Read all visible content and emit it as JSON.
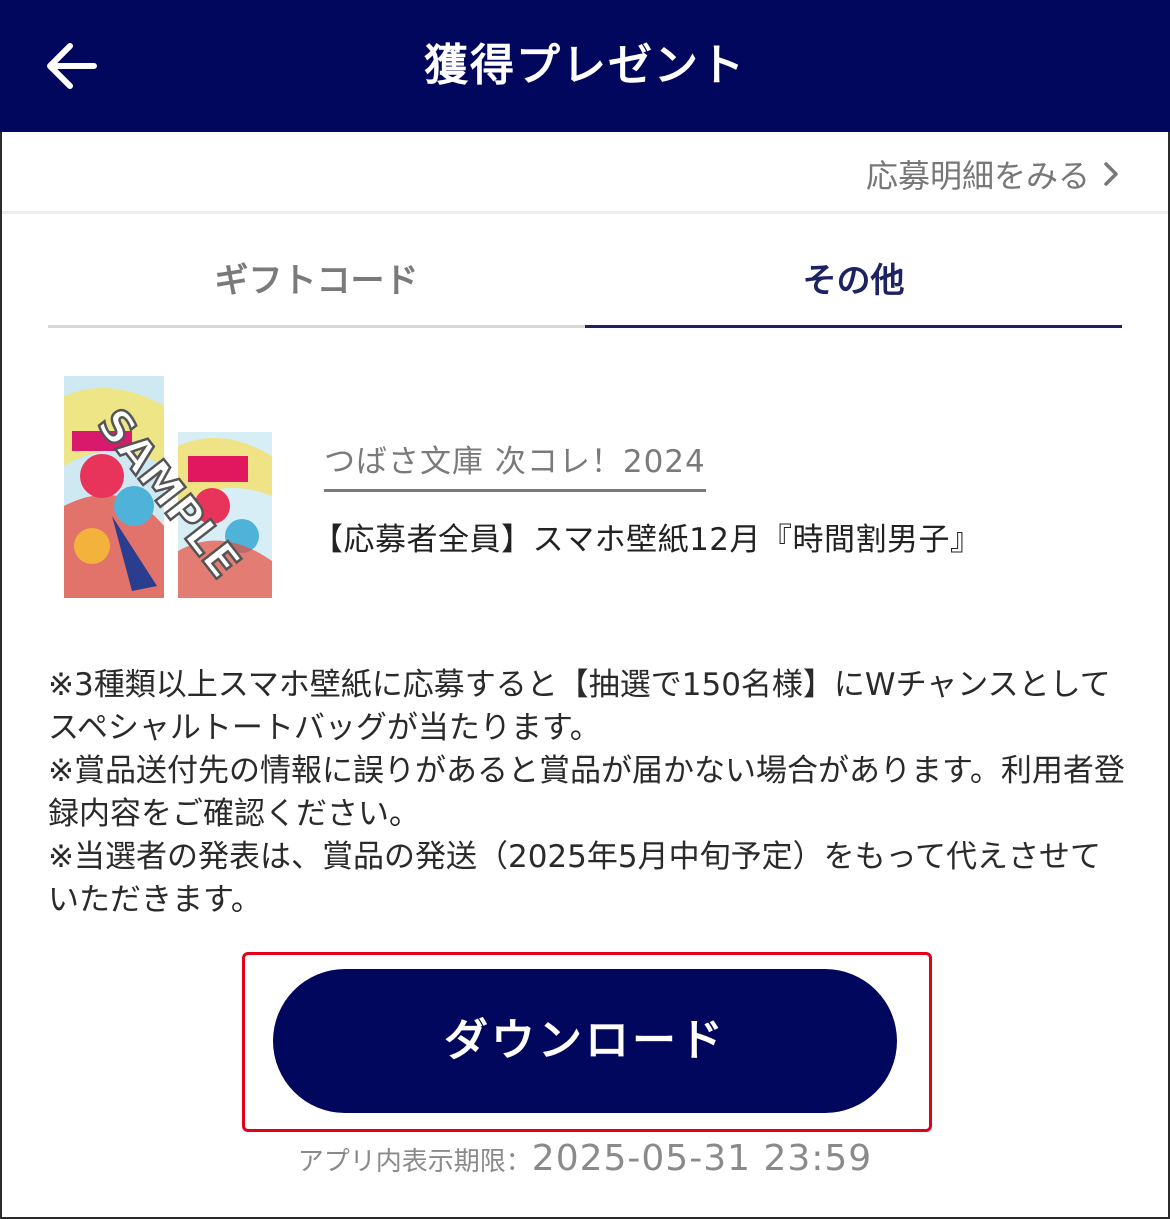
{
  "header": {
    "title": "獲得プレゼント",
    "back_icon": "arrow-left-icon"
  },
  "subbar": {
    "details_label": "応募明細をみる"
  },
  "tabs": [
    {
      "label": "ギフトコード",
      "selected": false
    },
    {
      "label": "その他",
      "selected": true
    }
  ],
  "prize": {
    "thumbnail_watermark": "SAMPLE",
    "campaign_label": "つばさ文庫 次コレ！2024",
    "title": "【応募者全員】スマホ壁紙12月『時間割男子』"
  },
  "notes": [
    "※3種類以上スマホ壁紙に応募すると【抽選で150名様】にWチャンスとしてスペシャルトートバッグが当たります。",
    "※賞品送付先の情報に誤りがあると賞品が届かない場合があります。利用者登録内容をご確認ください。",
    "※当選者の発表は、賞品の発送（2025年5月中旬予定）をもって代えさせていただきます。"
  ],
  "download": {
    "label": "ダウンロード"
  },
  "expiry": {
    "label": "アプリ内表示期限：",
    "value": "2025-05-31 23:59"
  },
  "colors": {
    "header_bg": "#02075e",
    "active_tab": "#1c2262",
    "highlight_outline": "#e3001b"
  }
}
